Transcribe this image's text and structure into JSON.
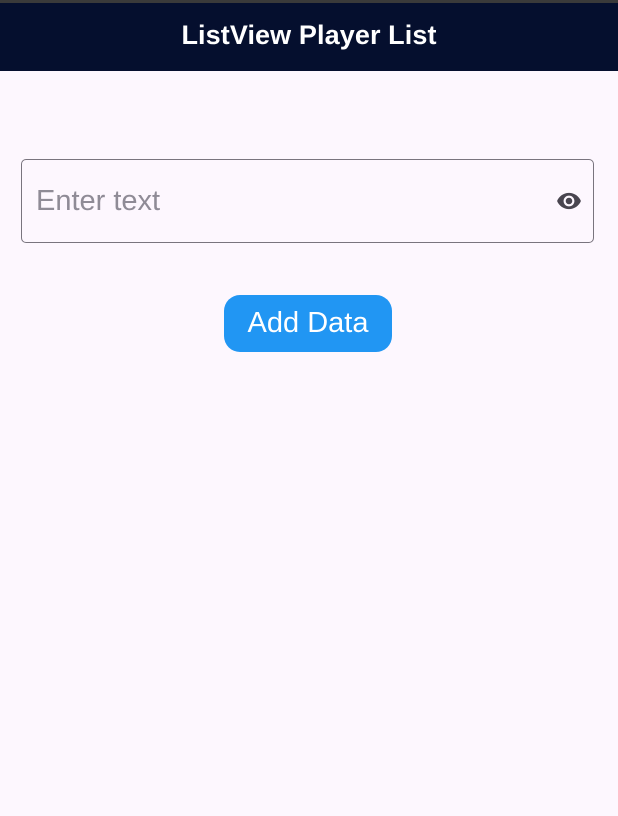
{
  "app_bar": {
    "title": "ListView Player List",
    "background": "#050f2e"
  },
  "text_field": {
    "value": "",
    "placeholder": "Enter text",
    "suffix_icon": "visibility-icon"
  },
  "add_button": {
    "label": "Add Data",
    "color": "#2196f3"
  },
  "player_list": {
    "items": []
  }
}
